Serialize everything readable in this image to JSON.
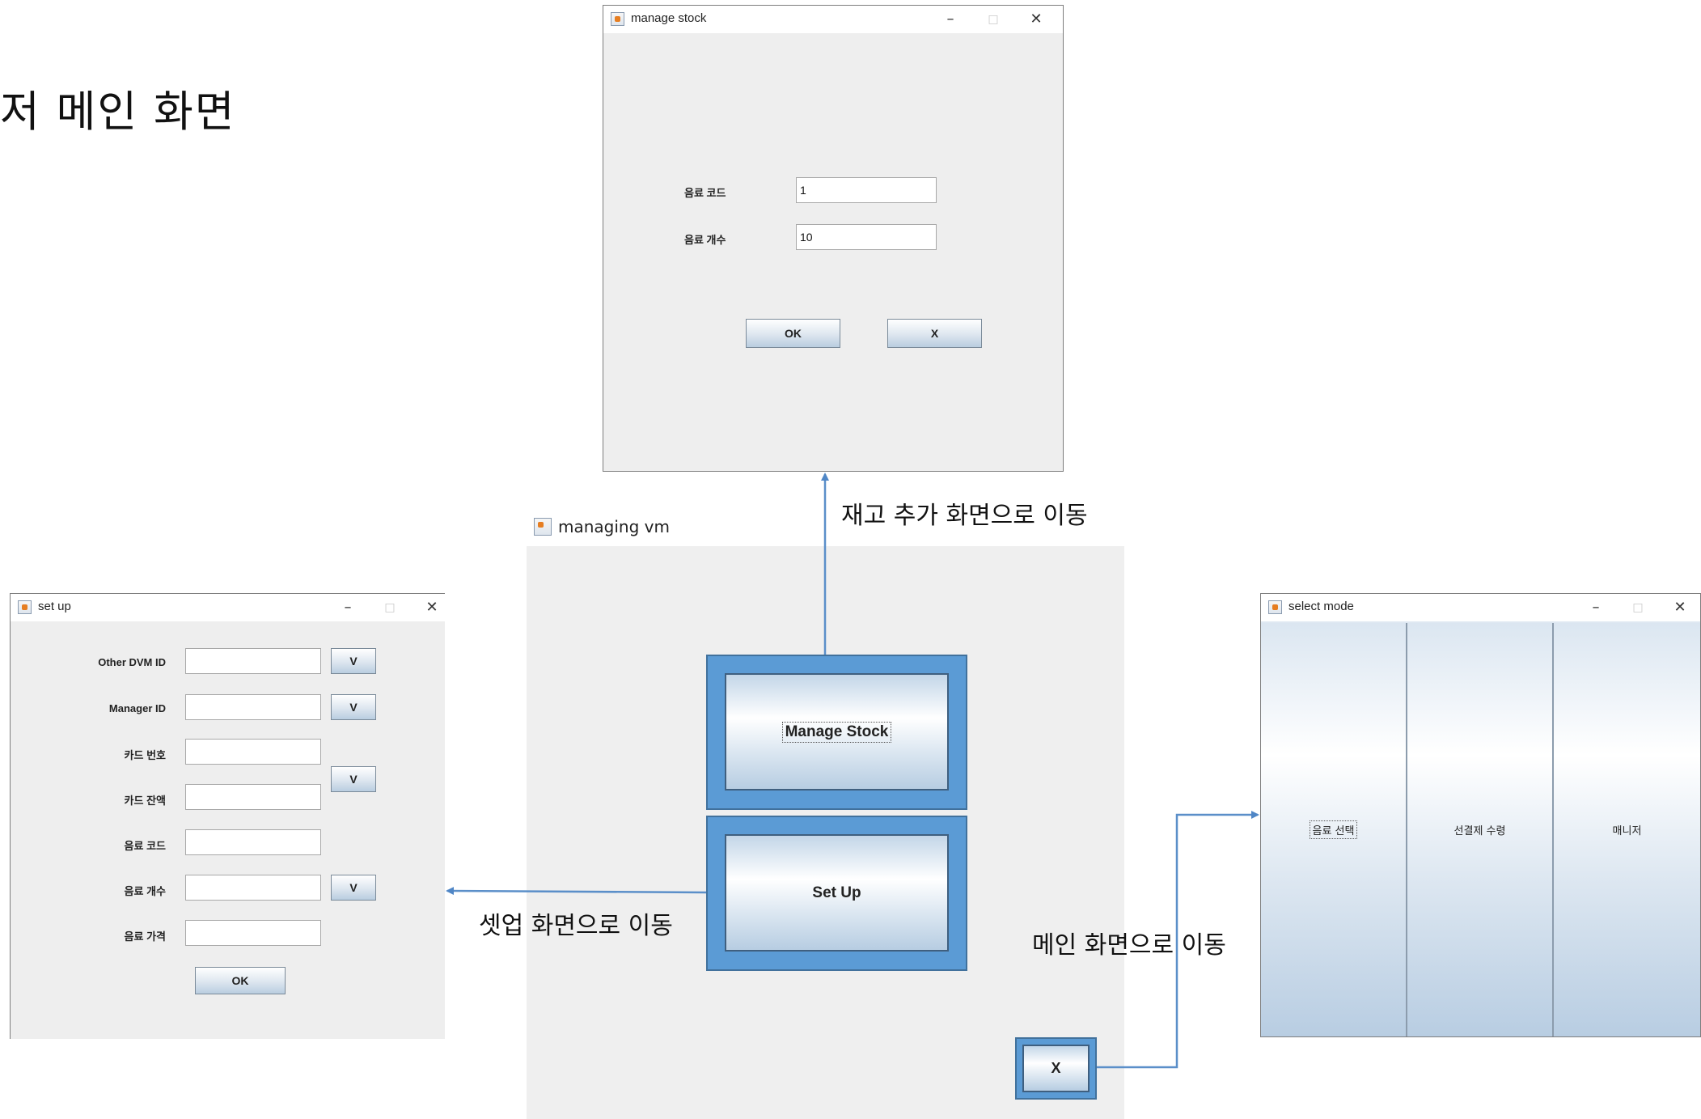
{
  "heading": "저 메인 화면",
  "annotations": {
    "to_stock": "재고 추가 화면으로 이동",
    "to_setup": "셋업 화면으로 이동",
    "to_main": "메인 화면으로 이동"
  },
  "window_controls": {
    "minimize": "–",
    "maximize": "□",
    "close": "✕"
  },
  "manage_stock": {
    "title": "manage stock",
    "code_label": "음료 코드",
    "code_value": "1",
    "count_label": "음료 개수",
    "count_value": "10",
    "ok": "OK",
    "cancel": "X"
  },
  "managing_vm": {
    "title": "managing vm",
    "manage_stock_button": "Manage Stock",
    "setup_button": "Set Up",
    "exit_button": "X"
  },
  "setup": {
    "title": "set up",
    "rows": [
      {
        "label": "Other DVM ID",
        "value": ""
      },
      {
        "label": "Manager ID",
        "value": ""
      },
      {
        "label": "카드 번호",
        "value": ""
      },
      {
        "label": "카드 잔액",
        "value": ""
      },
      {
        "label": "음료 코드",
        "value": ""
      },
      {
        "label": "음료 개수",
        "value": ""
      },
      {
        "label": "음료 가격",
        "value": ""
      }
    ],
    "v_button": "V",
    "ok": "OK"
  },
  "select_mode": {
    "title": "select mode",
    "options": [
      "음료 선택",
      "선결제 수령",
      "매니저"
    ]
  }
}
